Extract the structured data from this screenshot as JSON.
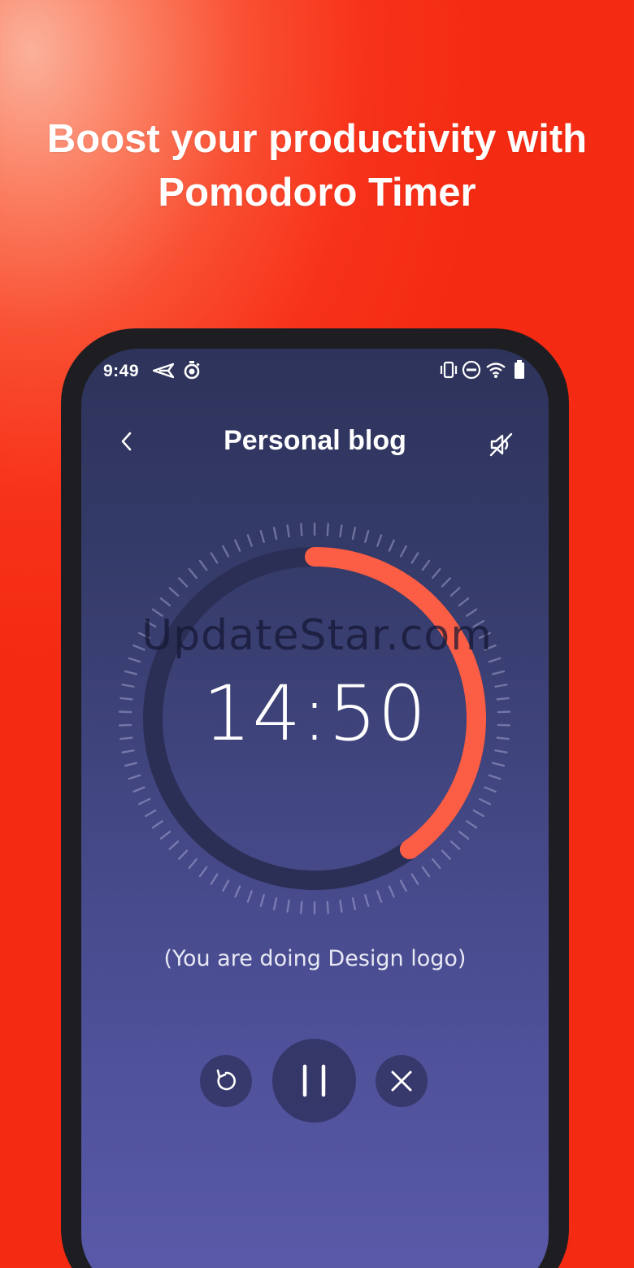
{
  "promo": {
    "headline_line1": "Boost your productivity with",
    "headline_line2": "Pomodoro Timer"
  },
  "status_bar": {
    "time": "9:49",
    "left_icons": [
      "send-icon",
      "stopwatch-icon"
    ],
    "right_icons": [
      "vibrate-icon",
      "do-not-disturb-icon",
      "wifi-icon",
      "battery-icon"
    ]
  },
  "header": {
    "back_icon": "chevron-left-icon",
    "title": "Personal blog",
    "sound_icon": "sound-off-icon"
  },
  "timer": {
    "display": "14:50",
    "progress_fraction": 0.4,
    "activity_text": "(You are doing Design logo)"
  },
  "controls": [
    {
      "name": "restart",
      "icon": "restart-icon"
    },
    {
      "name": "pause",
      "icon": "pause-icon"
    },
    {
      "name": "stop",
      "icon": "close-icon"
    }
  ],
  "watermark": "UpdateStar.com",
  "colors": {
    "accent": "#fb5e45",
    "background_top": "#ff8c70",
    "background_bottom": "#f42a12",
    "screen_top": "#2d335a",
    "screen_bottom": "#5a5aaa",
    "ring_track": "#2c2f55"
  }
}
